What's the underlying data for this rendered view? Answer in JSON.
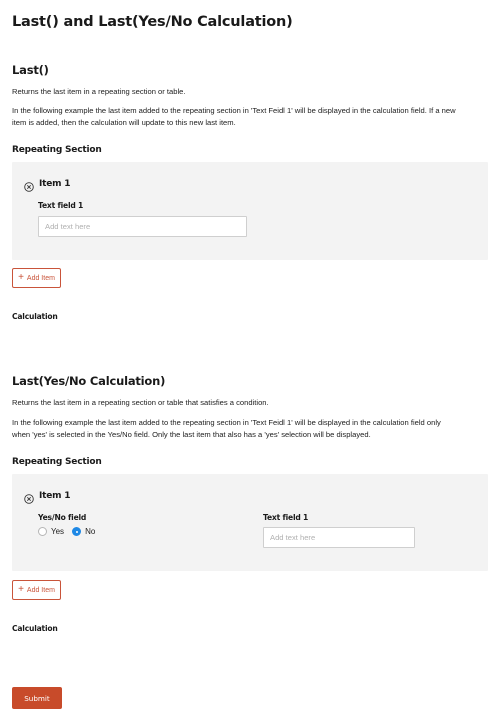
{
  "page": {
    "title": "Last() and Last(Yes/No Calculation)"
  },
  "section1": {
    "heading": "Last()",
    "description": "Returns the last item in a repeating section or table.",
    "example_line1": "In the following example the last item added to the repeating section in 'Text Feidl 1' will be displayed in the calculation field. If a new",
    "example_line2": "item is added, then the calculation will update to this new last item.",
    "repeating_label": "Repeating Section",
    "item_title": "Item 1",
    "text_field_label": "Text field 1",
    "text_field_placeholder": "Add text here",
    "text_field_value": "",
    "add_item_label": "Add Item",
    "calculation_label": "Calculation"
  },
  "section2": {
    "heading": "Last(Yes/No Calculation)",
    "description": "Returns the last item in a repeating section or table that satisfies a condition.",
    "example_line1": "In the following example the last item added to the repeating section in 'Text Feidl 1' will be displayed in the calculation field only",
    "example_line2": "when 'yes' is selected in the Yes/No field. Only the last item that also has a 'yes' selection will be displayed.",
    "repeating_label": "Repeating Section",
    "item_title": "Item 1",
    "yesno_label": "Yes/No field",
    "yes_label": "Yes",
    "no_label": "No",
    "selected": "No",
    "text_field_label": "Text field 1",
    "text_field_placeholder": "Add text here",
    "text_field_value": "",
    "add_item_label": "Add Item",
    "calculation_label": "Calculation"
  },
  "submit": {
    "label": "Submit"
  },
  "colors": {
    "accent": "#c9543a",
    "submit_bg": "#c84b2a",
    "radio_selected": "#1e88e5",
    "section_bg": "#f3f3f3"
  },
  "icons": {
    "remove_item": "circle-x-icon",
    "add": "plus-icon"
  }
}
